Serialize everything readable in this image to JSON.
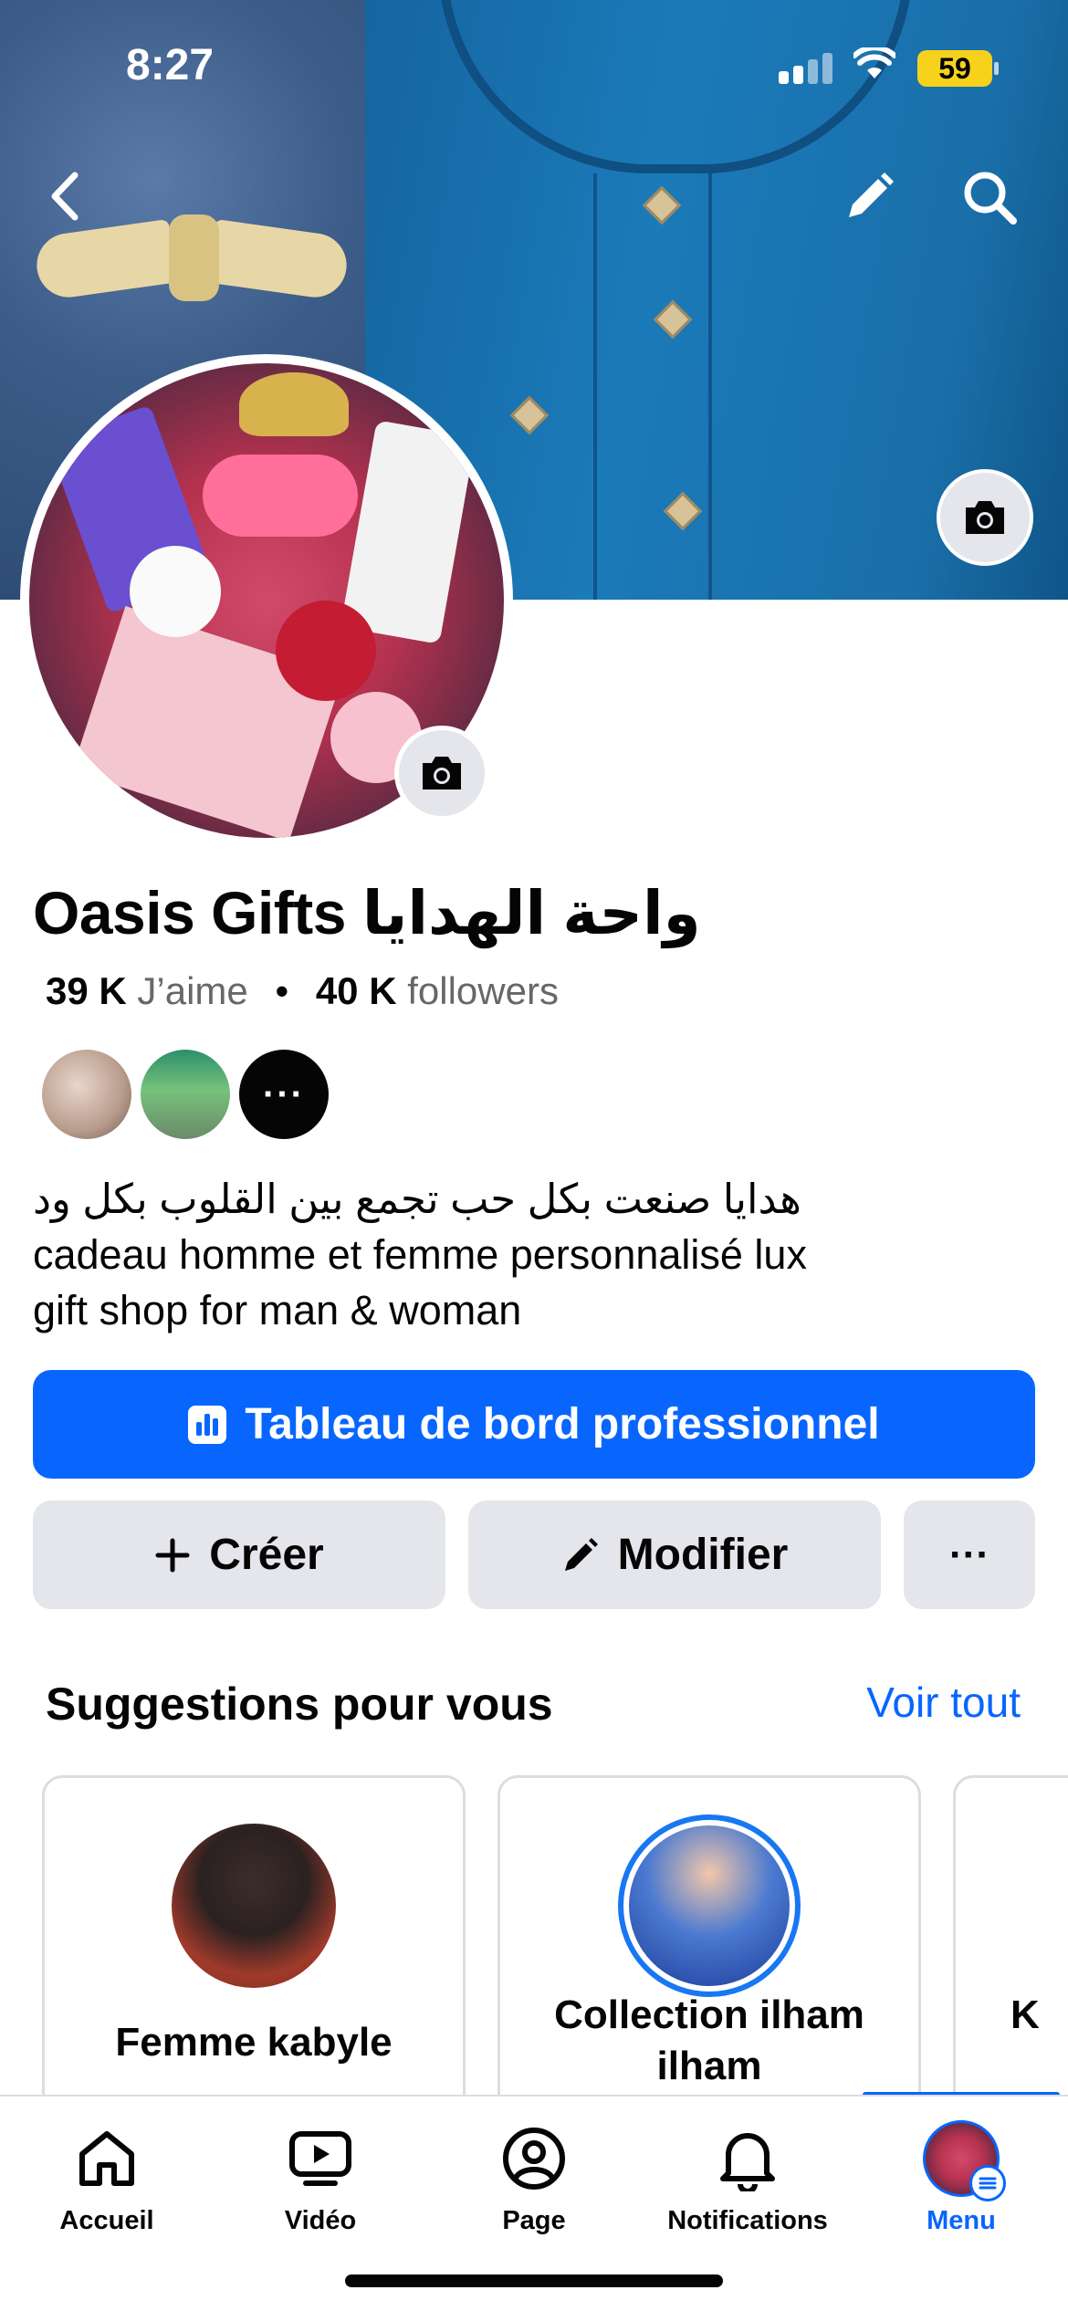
{
  "status_bar": {
    "time": "8:27",
    "battery": "59"
  },
  "header": {
    "icons": [
      "chevron-left-icon",
      "pencil-icon",
      "search-icon",
      "camera-icon"
    ]
  },
  "profile": {
    "name": "Oasis Gifts واحة الهدايا",
    "likes_count": "39 K",
    "likes_label": "J’aime",
    "followers_count": "40 K",
    "followers_label": "followers",
    "more_friends": "···",
    "bio": [
      "هدايا صنعت بكل حب تجمع بين القلوب بكل ود",
      "cadeau homme et femme personnalisé lux",
      "gift shop for man & woman"
    ]
  },
  "actions": {
    "dashboard": "Tableau de bord professionnel",
    "create": "Créer",
    "modify": "Modifier",
    "more": "···"
  },
  "suggestions": {
    "title": "Suggestions pour vous",
    "see_all": "Voir tout",
    "cards": [
      {
        "name": "Femme kabyle"
      },
      {
        "name": "Collection ilham ilham"
      },
      {
        "name": "K"
      }
    ]
  },
  "tabbar": {
    "items": [
      {
        "label": "Accueil",
        "icon": "home-icon"
      },
      {
        "label": "Vidéo",
        "icon": "video-icon"
      },
      {
        "label": "Page",
        "icon": "profile-icon"
      },
      {
        "label": "Notifications",
        "icon": "bell-icon"
      },
      {
        "label": "Menu",
        "icon": "menu-icon",
        "active": true
      }
    ]
  },
  "colors": {
    "accent": "#0866ff",
    "button_gray": "#e4e6eb",
    "text": "#050505",
    "muted": "#65676b"
  }
}
